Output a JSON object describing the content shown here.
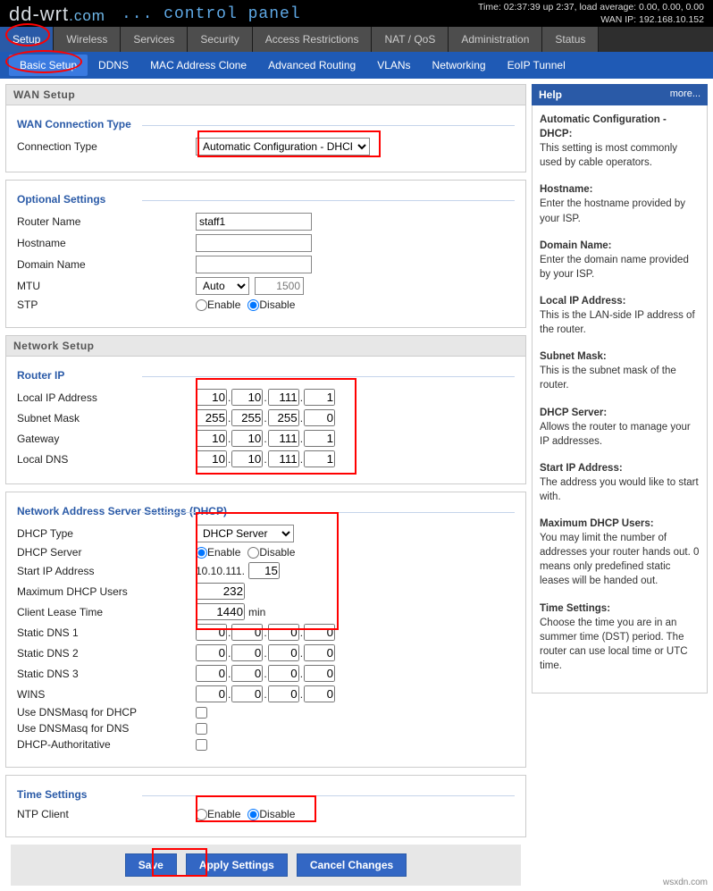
{
  "header": {
    "logo_dd": "dd-wrt",
    "logo_com": ".com",
    "subtitle": "... control panel",
    "time": "Time: 02:37:39 up 2:37, load average: 0.00, 0.00, 0.00",
    "wanip": "WAN IP: 192.168.10.152"
  },
  "tabs": [
    "Setup",
    "Wireless",
    "Services",
    "Security",
    "Access Restrictions",
    "NAT / QoS",
    "Administration",
    "Status"
  ],
  "subtabs": [
    "Basic Setup",
    "DDNS",
    "MAC Address Clone",
    "Advanced Routing",
    "VLANs",
    "Networking",
    "EoIP Tunnel"
  ],
  "wan": {
    "section": "WAN Setup",
    "fs": "WAN Connection Type",
    "conn_lbl": "Connection Type",
    "conn_val": "Automatic Configuration - DHCP"
  },
  "opt": {
    "fs": "Optional Settings",
    "router_lbl": "Router Name",
    "router_val": "staff1",
    "host_lbl": "Hostname",
    "host_val": "",
    "domain_lbl": "Domain Name",
    "domain_val": "",
    "mtu_lbl": "MTU",
    "mtu_mode": "Auto",
    "mtu_val": "1500",
    "stp_lbl": "STP",
    "enable": "Enable",
    "disable": "Disable"
  },
  "net": {
    "section": "Network Setup",
    "fs": "Router IP",
    "local_lbl": "Local IP Address",
    "local": [
      "10",
      "10",
      "111",
      "1"
    ],
    "mask_lbl": "Subnet Mask",
    "mask": [
      "255",
      "255",
      "255",
      "0"
    ],
    "gw_lbl": "Gateway",
    "gw": [
      "10",
      "10",
      "111",
      "1"
    ],
    "dns_lbl": "Local DNS",
    "dns": [
      "10",
      "10",
      "111",
      "1"
    ]
  },
  "dhcp": {
    "fs": "Network Address Server Settings (DHCP)",
    "type_lbl": "DHCP Type",
    "type_val": "DHCP Server",
    "srv_lbl": "DHCP Server",
    "enable": "Enable",
    "disable": "Disable",
    "start_lbl": "Start IP Address",
    "start_pfx": "10.10.111.",
    "start_val": "15",
    "max_lbl": "Maximum DHCP Users",
    "max_val": "232",
    "lease_lbl": "Client Lease Time",
    "lease_val": "1440",
    "lease_sfx": "min",
    "sdns1_lbl": "Static DNS 1",
    "sdns1": [
      "0",
      "0",
      "0",
      "0"
    ],
    "sdns2_lbl": "Static DNS 2",
    "sdns2": [
      "0",
      "0",
      "0",
      "0"
    ],
    "sdns3_lbl": "Static DNS 3",
    "sdns3": [
      "0",
      "0",
      "0",
      "0"
    ],
    "wins_lbl": "WINS",
    "wins": [
      "0",
      "0",
      "0",
      "0"
    ],
    "dm_dhcp_lbl": "Use DNSMasq for DHCP",
    "dm_dns_lbl": "Use DNSMasq for DNS",
    "auth_lbl": "DHCP-Authoritative"
  },
  "time": {
    "fs": "Time Settings",
    "ntp_lbl": "NTP Client",
    "enable": "Enable",
    "disable": "Disable"
  },
  "btns": {
    "save": "Save",
    "apply": "Apply Settings",
    "cancel": "Cancel Changes"
  },
  "help": {
    "title": "Help",
    "more": "more...",
    "h1": "Automatic Configuration - DHCP:",
    "t1": "This setting is most commonly used by cable operators.",
    "h2": "Hostname:",
    "t2": "Enter the hostname provided by your ISP.",
    "h3": "Domain Name:",
    "t3": "Enter the domain name provided by your ISP.",
    "h4": "Local IP Address:",
    "t4": "This is the LAN-side IP address of the router.",
    "h5": "Subnet Mask:",
    "t5": "This is the subnet mask of the router.",
    "h6": "DHCP Server:",
    "t6": "Allows the router to manage your IP addresses.",
    "h7": "Start IP Address:",
    "t7": "The address you would like to start with.",
    "h8": "Maximum DHCP Users:",
    "t8": "You may limit the number of addresses your router hands out. 0 means only predefined static leases will be handed out.",
    "h9": "Time Settings:",
    "t9": "Choose the time you are in an summer time (DST) period. The router can use local time or UTC time."
  },
  "watermark": "wsxdn.com"
}
